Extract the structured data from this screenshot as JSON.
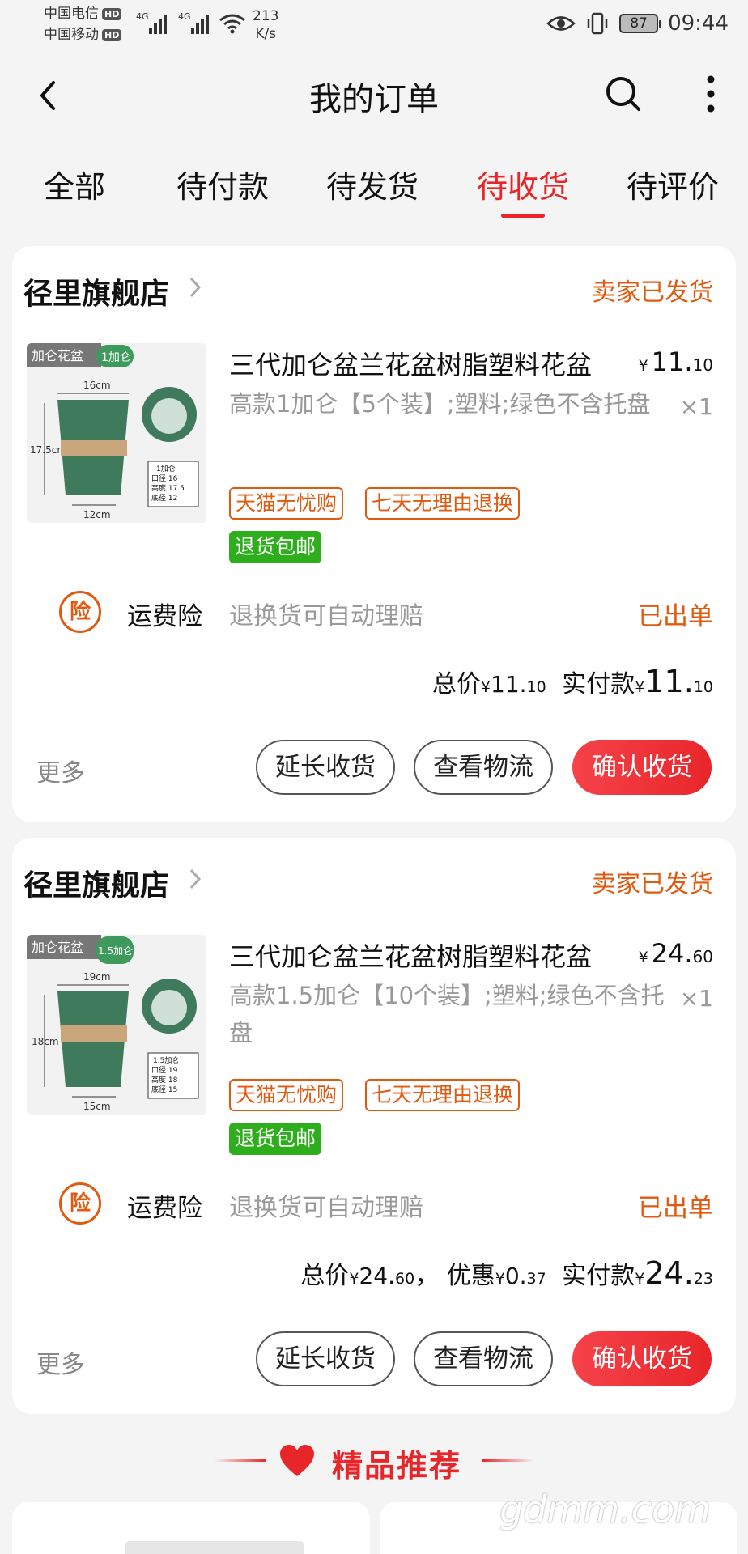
{
  "status_bar": {
    "carrier1": "中国电信",
    "carrier2": "中国移动",
    "hd": "HD",
    "network1": "4G",
    "network2": "4G",
    "speed_value": "213",
    "speed_unit": "K/s",
    "battery": "87",
    "time": "09:44"
  },
  "header": {
    "title": "我的订单"
  },
  "tabs": [
    {
      "label": "全部"
    },
    {
      "label": "待付款"
    },
    {
      "label": "待发货"
    },
    {
      "label": "待收货",
      "active": true
    },
    {
      "label": "待评价"
    }
  ],
  "orders": [
    {
      "shop": "径里旗舰店",
      "status": "卖家已发货",
      "product": {
        "name": "三代加仑盆兰花盆树脂塑料花盆",
        "spec": "高款1加仑【5个装】;塑料;绿色不含托盘",
        "price_int": "11.",
        "price_dec": "10",
        "qty": "×1",
        "image": {
          "badge_left": "加仑花盆",
          "badge_right": "1加仑",
          "top": "16cm",
          "side": "17.5cm",
          "bottom": "12cm",
          "table": [
            "1加仑",
            "口径 16",
            "高度 17.5",
            "底径 12"
          ]
        }
      },
      "tags": [
        "天猫无忧购",
        "七天无理由退换"
      ],
      "green_tag": "退货包邮",
      "insurance": {
        "icon": "险",
        "name": "运费险",
        "desc": "退换货可自动理赔",
        "status": "已出单"
      },
      "totals": {
        "total_label": "总价",
        "total_int": "11.",
        "total_dec": "10",
        "pay_label": "实付款",
        "pay_int": "11.",
        "pay_dec": "10"
      },
      "more": "更多",
      "buttons": {
        "extend": "延长收货",
        "logistics": "查看物流",
        "confirm": "确认收货"
      }
    },
    {
      "shop": "径里旗舰店",
      "status": "卖家已发货",
      "product": {
        "name": "三代加仑盆兰花盆树脂塑料花盆",
        "spec": "高款1.5加仑【10个装】;塑料;绿色不含托盘",
        "price_int": "24.",
        "price_dec": "60",
        "qty": "×1",
        "image": {
          "badge_left": "加仑花盆",
          "badge_right": "1.5加仑",
          "top": "19cm",
          "side": "18cm",
          "bottom": "15cm",
          "table": [
            "1.5加仑",
            "口径 19",
            "高度 18",
            "底径 15"
          ]
        }
      },
      "tags": [
        "天猫无忧购",
        "七天无理由退换"
      ],
      "green_tag": "退货包邮",
      "insurance": {
        "icon": "险",
        "name": "运费险",
        "desc": "退换货可自动理赔",
        "status": "已出单"
      },
      "totals": {
        "total_label": "总价",
        "total_int": "24.",
        "total_dec": "60",
        "discount_label": "优惠",
        "discount_int": "0.",
        "discount_dec": "37",
        "pay_label": "实付款",
        "pay_int": "24.",
        "pay_dec": "23"
      },
      "more": "更多",
      "buttons": {
        "extend": "延长收货",
        "logistics": "查看物流",
        "confirm": "确认收货"
      }
    }
  ],
  "recommend": {
    "title": "精品推荐"
  },
  "watermark": "gdmm.com",
  "currency": "¥",
  "colors": {
    "accent": "#e8262a",
    "orange": "#e05a10",
    "green": "#2eae1c",
    "pot": "#3f7a5c"
  }
}
